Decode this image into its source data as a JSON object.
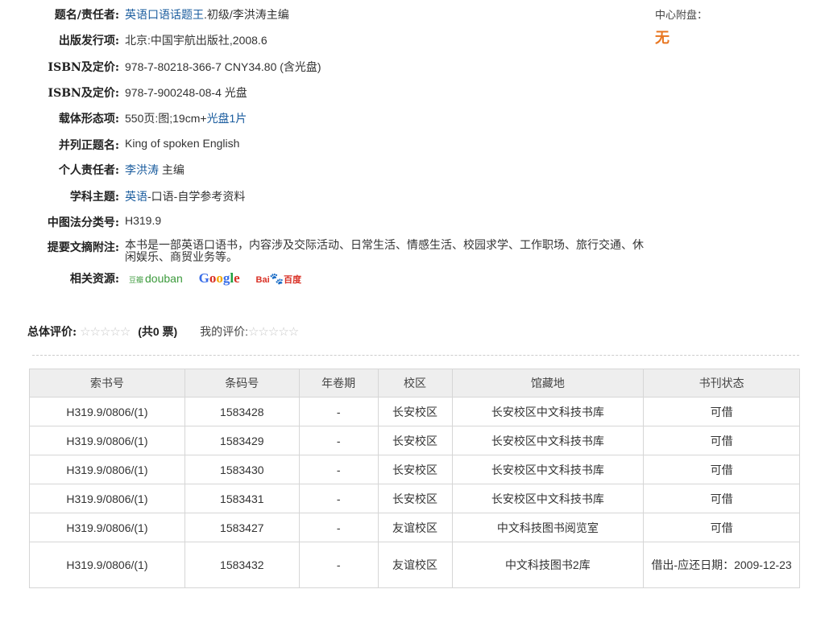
{
  "meta": {
    "title": {
      "label": "题名/责任者:",
      "link": "英语口语话题王",
      "rest": ".初级/李洪涛主编"
    },
    "publisher": {
      "label": "出版发行项:",
      "value": "北京:中国宇航出版社,2008.6"
    },
    "isbn1": {
      "label": "ISBN及定价:",
      "value": "978-7-80218-366-7 CNY34.80 (含光盘)"
    },
    "isbn2": {
      "label": "ISBN及定价:",
      "value": "978-7-900248-08-4 光盘"
    },
    "physical": {
      "label": "载体形态项:",
      "value": "550页:图;19cm+",
      "link": "光盘1片"
    },
    "parallel": {
      "label": "并列正题名:",
      "link": "King of spoken English"
    },
    "author": {
      "label": "个人责任者:",
      "link": "李洪涛",
      "rest": " 主编"
    },
    "subject": {
      "label": "学科主题:",
      "link": "英语",
      "rest": "-口语-自学参考资料"
    },
    "clc": {
      "label": "中图法分类号:",
      "link": "H319.9"
    },
    "abstract": {
      "label": "提要文摘附注:",
      "value": "本书是一部英语口语书，内容涉及交际活动、日常生活、情感生活、校园求学、工作职场、旅行交通、休闲娱乐、商贸业务等。"
    },
    "resources": {
      "label": "相关资源:",
      "douban_cn": "豆瓣",
      "douban": "douban",
      "google": [
        "G",
        "o",
        "o",
        "g",
        "l",
        "e"
      ],
      "baidu": "Bai",
      "baidu_paw": "🐾",
      "baidu_cn": "百度"
    }
  },
  "side": {
    "label": "中心附盘：",
    "value": "无"
  },
  "rating": {
    "label": "总体评价:",
    "stars": "☆☆☆☆☆",
    "count": "(共0 票)",
    "my_label": "我的评价:",
    "my_stars": "☆☆☆☆☆"
  },
  "holdings": {
    "headers": [
      "索书号",
      "条码号",
      "年卷期",
      "校区",
      "馆藏地",
      "书刊状态"
    ],
    "rows": [
      [
        "H319.9/0806/(1)",
        "1583428",
        "-",
        "长安校区",
        "长安校区中文科技书库",
        "可借"
      ],
      [
        "H319.9/0806/(1)",
        "1583429",
        "-",
        "长安校区",
        "长安校区中文科技书库",
        "可借"
      ],
      [
        "H319.9/0806/(1)",
        "1583430",
        "-",
        "长安校区",
        "长安校区中文科技书库",
        "可借"
      ],
      [
        "H319.9/0806/(1)",
        "1583431",
        "-",
        "长安校区",
        "长安校区中文科技书库",
        "可借"
      ],
      [
        "H319.9/0806/(1)",
        "1583427",
        "-",
        "友谊校区",
        "中文科技图书阅览室",
        "可借"
      ],
      [
        "H319.9/0806/(1)",
        "1583432",
        "-",
        "友谊校区",
        "中文科技图书2库",
        "借出-应还日期：2009-12-23"
      ]
    ]
  }
}
